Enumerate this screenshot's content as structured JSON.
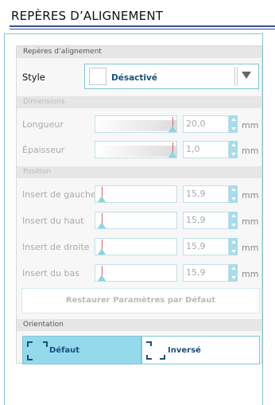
{
  "header": {
    "title": "REPÈRES D’ALIGNEMENT"
  },
  "section_alignment": {
    "label": "Repères d’alignement"
  },
  "style": {
    "label": "Style",
    "value": "Désactivé"
  },
  "section_dimensions": {
    "label": "Dimensions"
  },
  "section_position": {
    "label": "Position"
  },
  "rows": [
    {
      "label": "Longueur",
      "value": "20,0",
      "unit": "mm",
      "slider_fraction": 1.0
    },
    {
      "label": "Épaisseur",
      "value": "1,0",
      "unit": "mm",
      "slider_fraction": 1.0
    },
    {
      "label": "Insert de gauche",
      "value": "15,9",
      "unit": "mm",
      "slider_fraction": 0.0
    },
    {
      "label": "Insert du haut",
      "value": "15,9",
      "unit": "mm",
      "slider_fraction": 0.0
    },
    {
      "label": "Insert de droite",
      "value": "15,9",
      "unit": "mm",
      "slider_fraction": 0.0
    },
    {
      "label": "Insert du bas",
      "value": "15,9",
      "unit": "mm",
      "slider_fraction": 0.0
    }
  ],
  "restore_button": {
    "label": "Restaurer Paramètres par Défaut"
  },
  "section_orientation": {
    "label": "Orientation"
  },
  "orientation": {
    "default_label": "Défaut",
    "inverse_label": "Inversé",
    "selected": "Défaut"
  },
  "colors": {
    "accent": "#95d9ec",
    "border": "#7fc6d6",
    "title_rule": "#3d4f8a",
    "value_text": "#1a4f7a"
  },
  "icons": {
    "dropdown": "chevron-down-icon",
    "spinner": "spinner-icon",
    "crop_marks": "crop-marks-icon"
  }
}
